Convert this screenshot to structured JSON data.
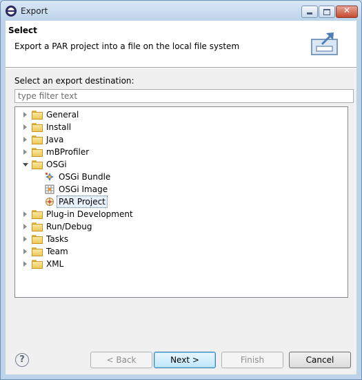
{
  "window": {
    "title": "Export",
    "close_glyph": "✕"
  },
  "banner": {
    "title": "Select",
    "description": "Export a PAR project into a file on the local file system",
    "icon": "export-icon"
  },
  "destination_label": "Select an export destination:",
  "filter": {
    "placeholder": "type filter text",
    "value": ""
  },
  "tree": {
    "items": [
      {
        "label": "General",
        "expanded": false,
        "icon": "folder-icon"
      },
      {
        "label": "Install",
        "expanded": false,
        "icon": "folder-icon"
      },
      {
        "label": "Java",
        "expanded": false,
        "icon": "folder-icon"
      },
      {
        "label": "mBProfiler",
        "expanded": false,
        "icon": "folder-icon"
      },
      {
        "label": "OSGi",
        "expanded": true,
        "icon": "folder-open-icon",
        "children": [
          {
            "label": "OSGi Bundle",
            "icon": "osgi-bundle-icon"
          },
          {
            "label": "OSGi Image",
            "icon": "osgi-image-icon"
          },
          {
            "label": "PAR Project",
            "icon": "par-project-icon",
            "selected": true
          }
        ]
      },
      {
        "label": "Plug-in Development",
        "expanded": false,
        "icon": "folder-icon"
      },
      {
        "label": "Run/Debug",
        "expanded": false,
        "icon": "folder-icon"
      },
      {
        "label": "Tasks",
        "expanded": false,
        "icon": "folder-icon"
      },
      {
        "label": "Team",
        "expanded": false,
        "icon": "folder-icon"
      },
      {
        "label": "XML",
        "expanded": false,
        "icon": "folder-icon"
      }
    ]
  },
  "help": {
    "glyph": "?"
  },
  "buttons": {
    "back": "< Back",
    "next": "Next >",
    "finish": "Finish",
    "cancel": "Cancel"
  }
}
